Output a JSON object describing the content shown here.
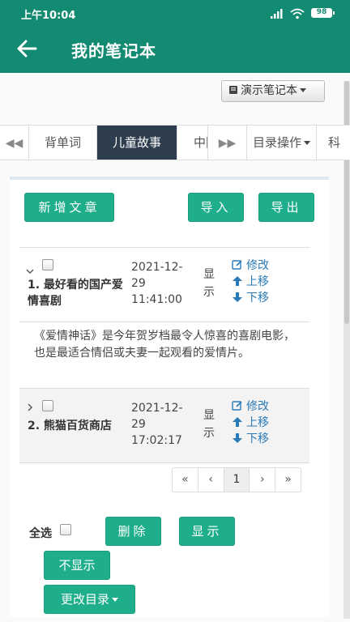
{
  "status_bar": {
    "time": "上午10:04",
    "battery": "98"
  },
  "app_bar": {
    "title": "我的笔记本"
  },
  "notebook_selector": {
    "label": "演示笔记本"
  },
  "tabs": [
    {
      "label": "背单词"
    },
    {
      "label": "儿童故事"
    },
    {
      "label": "中国"
    },
    {
      "label": "目录操作"
    },
    {
      "label": "科"
    }
  ],
  "toolbar": {
    "new_article": "新增文章",
    "import": "导入",
    "export": "导出"
  },
  "articles": [
    {
      "title": "1. 最好看的国产爱情喜剧",
      "date": "2021-12-29 11:41:00",
      "visibility": "显示",
      "actions": {
        "edit": "修改",
        "up": "上移",
        "down": "下移"
      },
      "description": "《爱情神话》是今年贺岁档最令人惊喜的喜剧电影，也是最适合情侣或夫妻一起观看的爱情片。"
    },
    {
      "title": "2. 熊猫百货商店",
      "date": "2021-12-29 17:02:17",
      "visibility": "显示",
      "actions": {
        "edit": "修改",
        "up": "上移",
        "down": "下移"
      }
    }
  ],
  "pagination": {
    "first": "«",
    "prev": "‹",
    "current": "1",
    "next": "›",
    "last": "»"
  },
  "bottom_actions": {
    "select_all": "全选",
    "delete": "删除",
    "show": "显示",
    "hide": "不显示",
    "change_category": "更改目录"
  },
  "colors": {
    "primary": "#138a72",
    "button": "#1fae8b",
    "link": "#2a7ab8",
    "active_tab": "#2e3e4e"
  }
}
